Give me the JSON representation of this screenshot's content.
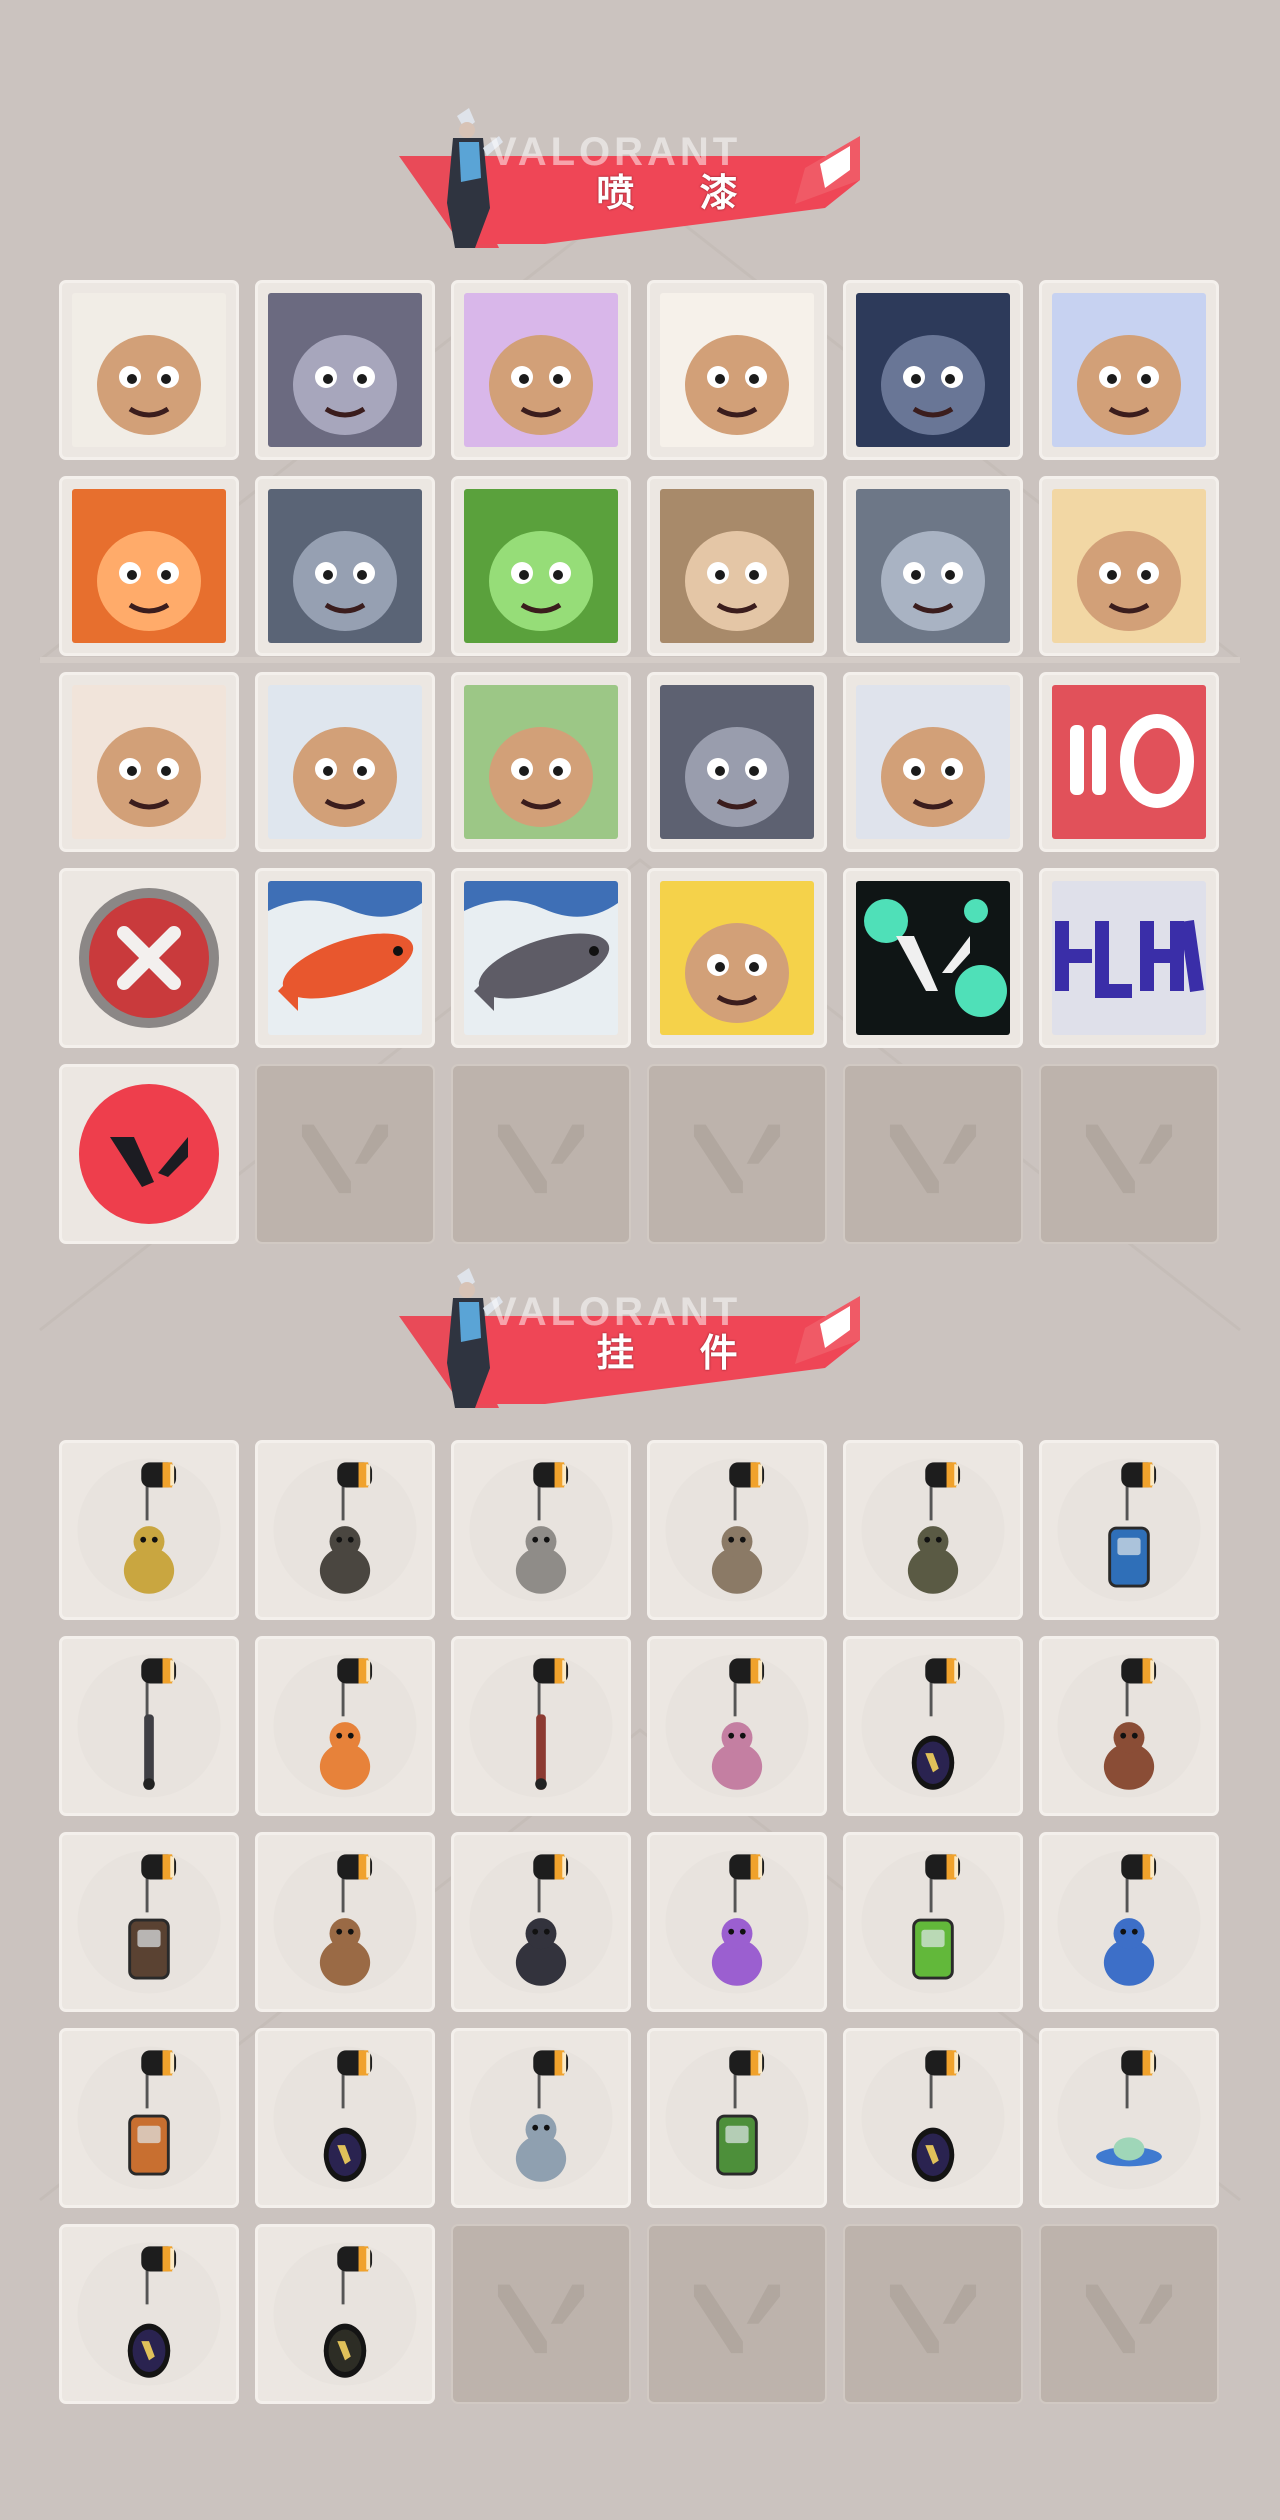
{
  "sections": [
    {
      "title": "喷 漆",
      "watermark": "VALORANT",
      "kind": "sprays",
      "items": [
        {
          "icon": "pixel-agent-spray-icon",
          "bg": "#f1ede6"
        },
        {
          "icon": "robot-face-spray-icon",
          "bg": "#6b6a80"
        },
        {
          "icon": "purple-ghost-spray-icon",
          "bg": "#d9b7ea"
        },
        {
          "icon": "clown-spray-icon",
          "bg": "#f6f1ea"
        },
        {
          "icon": "orange-dial-spray-icon",
          "bg": "#2d3a5a"
        },
        {
          "icon": "sunglasses-bear-spray-icon",
          "bg": "#c7d2f1"
        },
        {
          "icon": "bearded-agent-spray-icon",
          "bg": "#e76f2e"
        },
        {
          "icon": "anime-boy-spray-icon",
          "bg": "#5a6476"
        },
        {
          "icon": "green-crate-spray-icon",
          "bg": "#5aa13c"
        },
        {
          "icon": "green-eyes-closeup-spray-icon",
          "bg": "#a88a6a"
        },
        {
          "icon": "crying-creature-spray-icon",
          "bg": "#6d7787"
        },
        {
          "icon": "tiger-spray-icon",
          "bg": "#f2d7a4"
        },
        {
          "icon": "woman-face-spray-icon",
          "bg": "#f1e4da"
        },
        {
          "icon": "penguin-beanie-spray-icon",
          "bg": "#dfe6ee"
        },
        {
          "icon": "frog-hat-spray-icon",
          "bg": "#9cc786"
        },
        {
          "icon": "gray-cat-spray-icon",
          "bg": "#5d6171"
        },
        {
          "icon": "hooded-agent-spray-icon",
          "bg": "#dfe3ec"
        },
        {
          "icon": "ammo-counter-spray-icon",
          "bg": "#e1515a"
        },
        {
          "icon": "red-x-button-spray-icon",
          "bg": "#ece7e2"
        },
        {
          "icon": "orange-koi-spray-icon",
          "bg": "#e8eef2"
        },
        {
          "icon": "gray-koi-spray-icon",
          "bg": "#e8eef2"
        },
        {
          "icon": "pistol-chick-spray-icon",
          "bg": "#f5d24a"
        },
        {
          "icon": "valorant-logo-splatter-spray-icon",
          "bg": "#0f1515"
        },
        {
          "icon": "purple-graffiti-spray-icon",
          "bg": "#dfe0ea"
        },
        {
          "icon": "red-valorant-logo-spray-icon",
          "bg": "#ece7e2"
        },
        null,
        null,
        null,
        null,
        null
      ]
    },
    {
      "title": "挂 件",
      "watermark": "VALORANT",
      "kind": "buddies",
      "items": [
        {
          "icon": "gold-cat-buddy-icon",
          "color": "#c9a640"
        },
        {
          "icon": "drone-robot-buddy-icon",
          "color": "#4a4640"
        },
        {
          "icon": "treasure-chest-buddy-icon",
          "color": "#8f8c88"
        },
        {
          "icon": "armored-critter-buddy-icon",
          "color": "#8b7a66"
        },
        {
          "icon": "grenade-pouch-buddy-icon",
          "color": "#5a5a44"
        },
        {
          "icon": "battery-canister-buddy-icon",
          "color": "#2f6fb8"
        },
        {
          "icon": "spiked-sword-buddy-icon",
          "color": "#3f3f44"
        },
        {
          "icon": "flame-chili-buddy-icon",
          "color": "#e7823a"
        },
        {
          "icon": "braided-cord-buddy-icon",
          "color": "#8c3a32"
        },
        {
          "icon": "cupcake-buddy-icon",
          "color": "#c47fa2"
        },
        {
          "icon": "ep9-medal-buddy-icon",
          "color": "#2a2350"
        },
        {
          "icon": "teddy-bear-bell-buddy-icon",
          "color": "#8a4d36"
        },
        {
          "icon": "radio-device-buddy-icon",
          "color": "#5a4232"
        },
        {
          "icon": "cardboard-box-buddy-icon",
          "color": "#9a6a45"
        },
        {
          "icon": "witch-doll-buddy-icon",
          "color": "#33333d"
        },
        {
          "icon": "lava-lamp-buddy-icon",
          "color": "#9b5fd0"
        },
        {
          "icon": "green-gameboy-buddy-icon",
          "color": "#62b83a"
        },
        {
          "icon": "astronaut-buddy-icon",
          "color": "#3d6fc8"
        },
        {
          "icon": "orange-radio-buddy-icon",
          "color": "#c86f30"
        },
        {
          "icon": "ep9-medal-buddy-icon",
          "color": "#2a2350"
        },
        {
          "icon": "agent-card-buddy-icon",
          "color": "#8fa0b0"
        },
        {
          "icon": "green-can-buddy-icon",
          "color": "#4d8f3a"
        },
        {
          "icon": "ep9-medal-buddy-icon",
          "color": "#2a2350"
        },
        {
          "icon": "ufo-buddy-icon",
          "color": "#3f7ad0"
        },
        {
          "icon": "ep7-medal-buddy-icon",
          "color": "#2a2350"
        },
        {
          "icon": "valorant-coin-buddy-icon",
          "color": "#2d2d25"
        },
        null,
        null,
        null,
        null
      ]
    }
  ]
}
